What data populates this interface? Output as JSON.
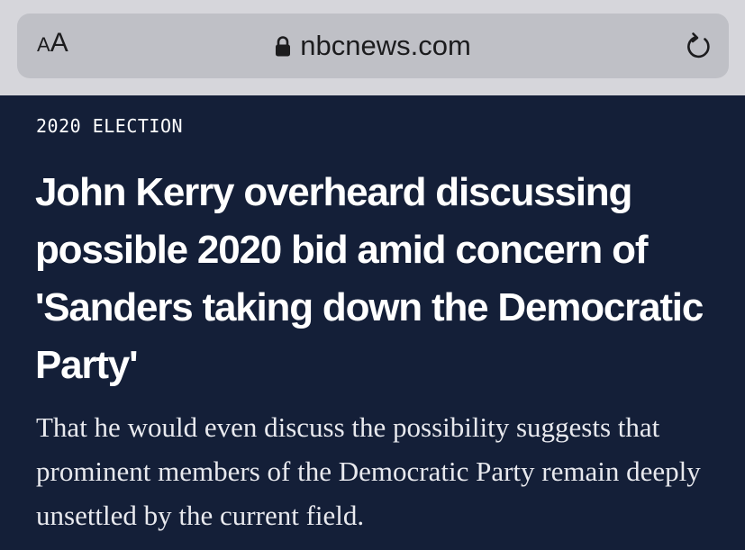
{
  "browser": {
    "text_size_small": "A",
    "text_size_large": "A",
    "url": "nbcnews.com",
    "icons": {
      "lock": "lock-icon",
      "reload": "reload-icon"
    }
  },
  "article": {
    "section": "2020 ELECTION",
    "headline": "John Kerry overheard discussing possible 2020 bid amid concern of 'Sanders taking down the Democratic Party'",
    "dek": "That he would even discuss the possibility suggests that prominent members of the Democratic Party remain deeply unsettled by the current field."
  },
  "colors": {
    "page_background": "#141f38",
    "browser_chrome": "#d6d6db",
    "url_field": "#bfc0c6",
    "text": "#ffffff"
  }
}
